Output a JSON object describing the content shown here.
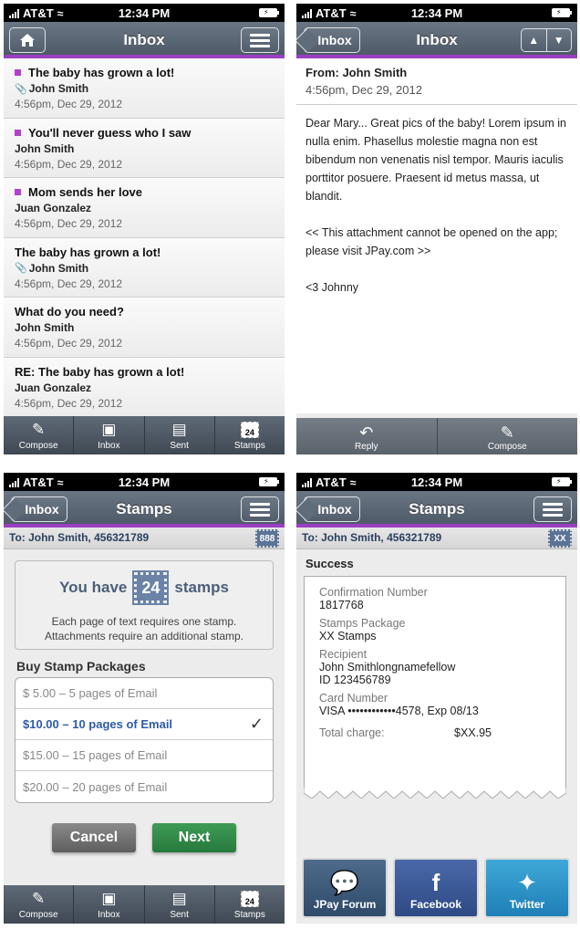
{
  "status": {
    "carrier": "AT&T",
    "time": "12:34 PM"
  },
  "colors": {
    "accent": "#9b3fc2",
    "navbar": "#5e6977",
    "link": "#2d5aa8",
    "next": "#2f8a47"
  },
  "inbox_screen": {
    "title": "Inbox",
    "messages": [
      {
        "subject": "The baby has grown a lot!",
        "from": "John Smith",
        "date": "4:56pm, Dec 29, 2012",
        "unread": true,
        "attachment": true
      },
      {
        "subject": "You'll never guess who I saw",
        "from": "John Smith",
        "date": "4:56pm, Dec 29, 2012",
        "unread": true,
        "attachment": false
      },
      {
        "subject": "Mom sends her love",
        "from": "Juan Gonzalez",
        "date": "4:56pm, Dec 29, 2012",
        "unread": true,
        "attachment": false
      },
      {
        "subject": "The baby has grown a lot!",
        "from": "John Smith",
        "date": "4:56pm, Dec 29, 2012",
        "unread": false,
        "attachment": true
      },
      {
        "subject": "What do you need?",
        "from": "John Smith",
        "date": "4:56pm, Dec 29, 2012",
        "unread": false,
        "attachment": false
      },
      {
        "subject": "RE: The baby has grown a lot!",
        "from": "Juan Gonzalez",
        "date": "4:56pm, Dec 29, 2012",
        "unread": false,
        "attachment": false
      }
    ]
  },
  "tabbar": {
    "compose": "Compose",
    "inbox": "Inbox",
    "sent": "Sent",
    "stamps": "Stamps",
    "stamp_count": "24"
  },
  "message_screen": {
    "back_label": "Inbox",
    "title": "Inbox",
    "from_line": "From: John Smith",
    "date": "4:56pm, Dec 29, 2012",
    "body_paragraph": "Dear Mary... Great pics of the baby! Lorem ipsum in nulla enim. Phasellus molestie magna non est bibendum non venenatis nisl tempor. Mauris iaculis porttitor posuere. Praesent id metus massa, ut blandit.",
    "attachment_note": "<< This attachment cannot be opened on the app; please visit JPay.com >>",
    "signature": "<3 Johnny",
    "reply_label": "Reply",
    "compose_label": "Compose"
  },
  "stamps_screen": {
    "back_label": "Inbox",
    "title": "Stamps",
    "to_line": "To: John Smith, 456321789",
    "badge": "888",
    "you_have": "You have",
    "stamp_count": "24",
    "stamps_word": "stamps",
    "note_line1": "Each page of text requires one stamp.",
    "note_line2": "Attachments require an additional stamp.",
    "buy_title": "Buy Stamp Packages",
    "packages": [
      {
        "label": "$ 5.00 –  5 pages of Email",
        "selected": false
      },
      {
        "label": "$10.00 – 10 pages of Email",
        "selected": true
      },
      {
        "label": "$15.00 – 15 pages of Email",
        "selected": false
      },
      {
        "label": "$20.00 – 20 pages of Email",
        "selected": false
      }
    ],
    "cancel_label": "Cancel",
    "next_label": "Next"
  },
  "success_screen": {
    "back_label": "Inbox",
    "title": "Stamps",
    "to_line": "To: John Smith, 456321789",
    "badge": "XX",
    "success_title": "Success",
    "confirmation_label": "Confirmation Number",
    "confirmation_value": "1817768",
    "package_label": "Stamps Package",
    "package_value": "XX Stamps",
    "recipient_label": "Recipient",
    "recipient_name": "John Smithlongnamefellow",
    "recipient_id": "ID 123456789",
    "card_label": "Card Number",
    "card_value": "VISA ••••••••••••4578, Exp 08/13",
    "total_label": "Total charge:",
    "total_value": "$XX.95",
    "social": {
      "forum": "JPay Forum",
      "facebook": "Facebook",
      "twitter": "Twitter"
    }
  }
}
